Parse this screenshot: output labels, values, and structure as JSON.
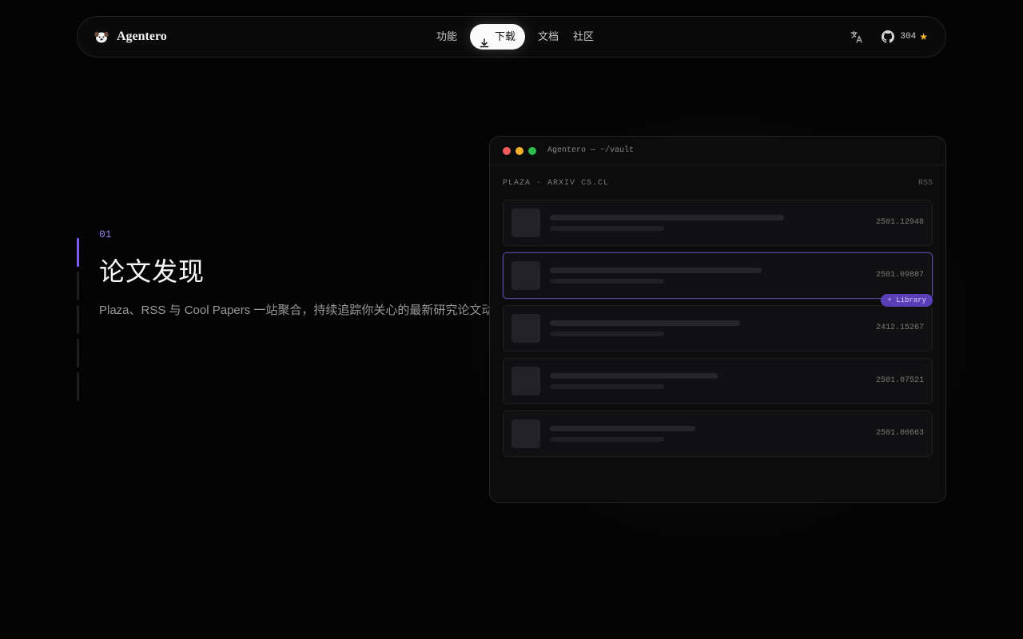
{
  "brand": {
    "name": "Agentero"
  },
  "nav": {
    "links": [
      "功能",
      "下载",
      "文档",
      "社区"
    ],
    "github_stars": "304"
  },
  "feature": {
    "number": "01",
    "title": "论文发现",
    "description": "Plaza、RSS 与 Cool Papers 一站聚合，持续追踪你关心的最新研究论文动态"
  },
  "window": {
    "title": "Agentero — ~/vault",
    "source_label": "PLAZA · ARXIV CS.CL",
    "rss_label": "RSS",
    "badge_label": "+ Library",
    "papers": [
      {
        "id": "2501.12948"
      },
      {
        "id": "2501.09887"
      },
      {
        "id": "2412.15267"
      },
      {
        "id": "2501.07521"
      },
      {
        "id": "2501.00663"
      }
    ]
  },
  "colors": {
    "accent": "#7c5cf0",
    "badge": "#5b3fb8",
    "star": "#f5b82e",
    "background": "#040404"
  },
  "icons": [
    "dog-logo-icon",
    "download-icon",
    "translate-icon",
    "github-icon",
    "star-icon"
  ]
}
